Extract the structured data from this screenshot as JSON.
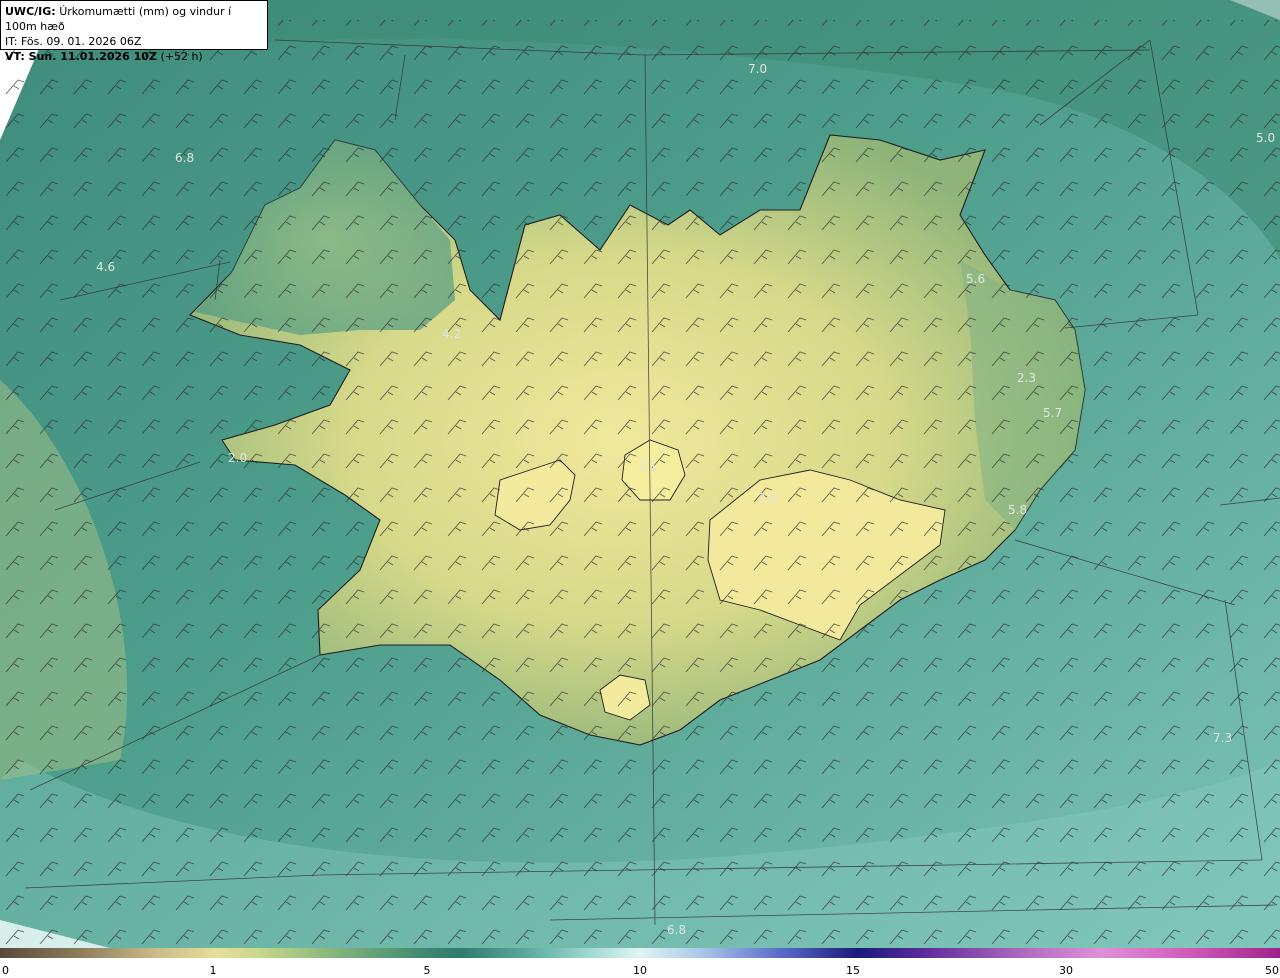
{
  "header": {
    "model": "UWC/IG:",
    "title": "Úrkomumætti (mm) og vindur í 100m hæð",
    "it_line": "IT: Fös. 09. 01. 2026 06Z",
    "vt_label": "VT: Sun. 11.01.2026 10Z",
    "vt_suffix": "(+52 h)"
  },
  "map_values": [
    "7.0",
    "5.0",
    "6.8",
    "4.6",
    "4.2",
    "5.6",
    "2.3",
    "5.7",
    "2.0",
    "2.1",
    "2.0",
    "5.8",
    "7.3",
    "6.8"
  ],
  "colorbar": {
    "ticks": [
      "0",
      "1",
      "5",
      "10",
      "15",
      "30",
      "50"
    ],
    "colors": [
      "#5a4a3a",
      "#e6df9a",
      "#3f8a72",
      "#dff5f5",
      "#1a1a7a",
      "#e090d8",
      "#a0208a"
    ]
  },
  "colors": {
    "sea": "#4c9e90",
    "land_low": "#a6c07a",
    "land_high": "#eee597",
    "coast": "#1e1e1e"
  }
}
